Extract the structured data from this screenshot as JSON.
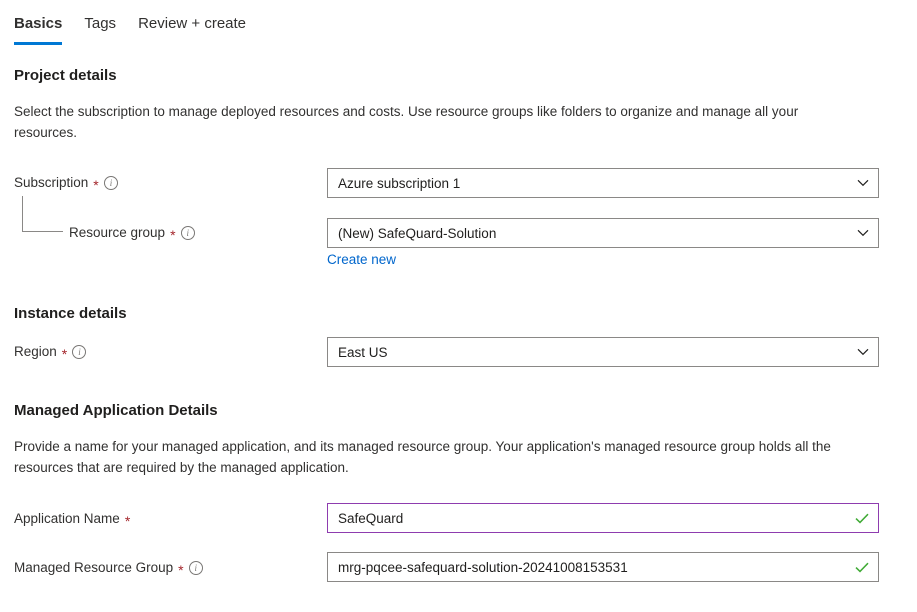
{
  "tabs": [
    {
      "label": "Basics",
      "selected": true
    },
    {
      "label": "Tags",
      "selected": false
    },
    {
      "label": "Review + create",
      "selected": false
    }
  ],
  "sections": {
    "project_details": {
      "title": "Project details",
      "description": "Select the subscription to manage deployed resources and costs. Use resource groups like folders to organize and manage all your resources."
    },
    "instance_details": {
      "title": "Instance details"
    },
    "managed_application_details": {
      "title": "Managed Application Details",
      "description": "Provide a name for your managed application, and its managed resource group. Your application's managed resource group holds all the resources that are required by the managed application."
    }
  },
  "fields": {
    "subscription": {
      "label": "Subscription",
      "required_marker": "*",
      "info_icon": "info-icon",
      "value": "Azure subscription 1",
      "chevron_icon": "chevron-down-icon"
    },
    "resource_group": {
      "label": "Resource group",
      "required_marker": "*",
      "info_icon": "info-icon",
      "value": "(New) SafeQuard-Solution",
      "chevron_icon": "chevron-down-icon",
      "create_new_link": "Create new"
    },
    "region": {
      "label": "Region",
      "required_marker": "*",
      "info_icon": "info-icon",
      "value": "East US",
      "chevron_icon": "chevron-down-icon"
    },
    "application_name": {
      "label": "Application Name",
      "required_marker": "*",
      "value": "SafeQuard",
      "placeholder": "",
      "valid_icon": "checkmark-icon"
    },
    "managed_resource_group": {
      "label": "Managed Resource Group",
      "required_marker": "*",
      "info_icon": "info-icon",
      "value": "mrg-pqcee-safequard-solution-20241008153531",
      "placeholder": "",
      "valid_icon": "checkmark-icon"
    }
  },
  "colors": {
    "accent": "#0078d4",
    "link": "#0066cc",
    "required": "#a4262c",
    "valid": "#3faa35",
    "focus_border": "#8e3caf",
    "border": "#8a8886"
  }
}
